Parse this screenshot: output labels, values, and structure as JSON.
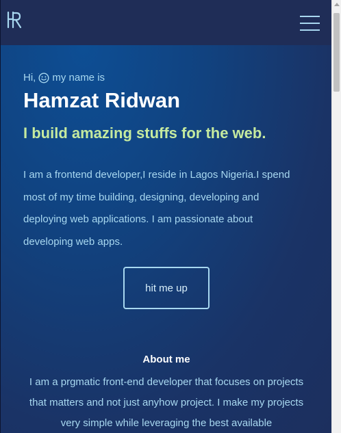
{
  "header": {
    "logo_icon": "hr-monogram-logo",
    "menu_icon": "hamburger-menu-icon"
  },
  "hero": {
    "greeting_prefix": "Hi,",
    "greeting_icon": "smiley-face-icon",
    "greeting_suffix": "my name is",
    "name": "Hamzat Ridwan",
    "tagline": "I build amazing stuffs for the web.",
    "intro": "I am a frontend developer,I reside in Lagos Nigeria.I spend most of my time building, designing, developing and deploying web applications. I am passionate about developing web apps.",
    "cta_label": "hit me up"
  },
  "about": {
    "title": "About me",
    "text": "I am a prgmatic front-end developer that focuses on projects that matters and not just anyhow project. I make my projects very simple while leveraging the best available"
  },
  "colors": {
    "accent": "#a8d8f0",
    "tagline": "#c5ea9f",
    "topbar": "#1f2d57"
  }
}
